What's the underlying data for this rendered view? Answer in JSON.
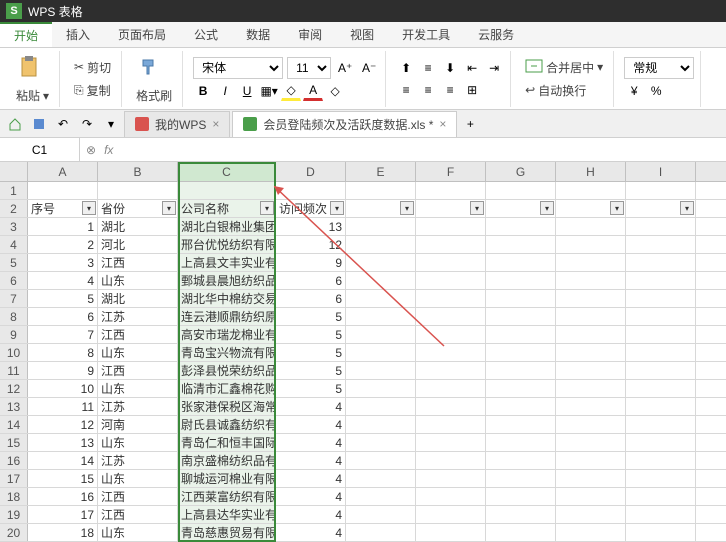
{
  "app": {
    "title": "WPS 表格",
    "logo": "S"
  },
  "menu": {
    "items": [
      "开始",
      "插入",
      "页面布局",
      "公式",
      "数据",
      "审阅",
      "视图",
      "开发工具",
      "云服务"
    ],
    "active_index": 0
  },
  "ribbon": {
    "paste": "粘贴",
    "cut": "剪切",
    "copy": "复制",
    "format_painter": "格式刷",
    "font_name": "宋体",
    "font_size": "11",
    "bold": "B",
    "italic": "I",
    "underline": "U",
    "merge_center": "合并居中",
    "wrap_text": "自动换行",
    "normal": "常规"
  },
  "tabs": {
    "my_wps": "我的WPS",
    "doc_name": "会员登陆频次及活跃度数据.xls *"
  },
  "namebox": {
    "cell": "C1",
    "fx": "fx"
  },
  "columns": [
    "A",
    "B",
    "C",
    "D",
    "E",
    "F",
    "G",
    "H",
    "I"
  ],
  "selected_col_index": 2,
  "header_row": {
    "A": "序号",
    "B": "省份",
    "C": "公司名称",
    "D": "访问频次"
  },
  "data_rows": [
    {
      "n": 1,
      "prov": "湖北",
      "co": "湖北白银棉业集团",
      "v": 13
    },
    {
      "n": 2,
      "prov": "河北",
      "co": "邢台优悦纺织有限",
      "v": 12
    },
    {
      "n": 3,
      "prov": "江西",
      "co": "上高县文丰实业有",
      "v": 9
    },
    {
      "n": 4,
      "prov": "山东",
      "co": "鄄城县晨旭纺织品",
      "v": 6
    },
    {
      "n": 5,
      "prov": "湖北",
      "co": "湖北华中棉纺交易",
      "v": 6
    },
    {
      "n": 6,
      "prov": "江苏",
      "co": "连云港顺鼎纺织原",
      "v": 5
    },
    {
      "n": 7,
      "prov": "江西",
      "co": "高安市瑞龙棉业有",
      "v": 5
    },
    {
      "n": 8,
      "prov": "山东",
      "co": "青岛宝兴物流有限",
      "v": 5
    },
    {
      "n": 9,
      "prov": "江西",
      "co": "彭泽县悦荣纺织品",
      "v": 5
    },
    {
      "n": 10,
      "prov": "山东",
      "co": "临清市汇鑫棉花购",
      "v": 5
    },
    {
      "n": 11,
      "prov": "江苏",
      "co": "张家港保税区海常",
      "v": 4
    },
    {
      "n": 12,
      "prov": "河南",
      "co": "尉氏县诚鑫纺织有",
      "v": 4
    },
    {
      "n": 13,
      "prov": "山东",
      "co": "青岛仁和恒丰国际",
      "v": 4
    },
    {
      "n": 14,
      "prov": "江苏",
      "co": "南京盛棉纺织品有",
      "v": 4
    },
    {
      "n": 15,
      "prov": "山东",
      "co": "聊城运河棉业有限",
      "v": 4
    },
    {
      "n": 16,
      "prov": "江西",
      "co": "江西莱富纺织有限",
      "v": 4
    },
    {
      "n": 17,
      "prov": "江西",
      "co": "上高县达华实业有",
      "v": 4
    },
    {
      "n": 18,
      "prov": "山东",
      "co": "青岛慈惠贸易有限",
      "v": 4
    }
  ]
}
